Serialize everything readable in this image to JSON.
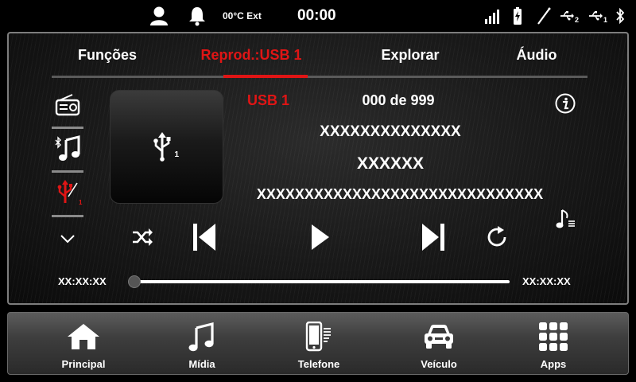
{
  "status": {
    "temperature": "00°C Ext",
    "clock": "00:00",
    "icons": [
      "user-icon",
      "bell-icon",
      "signal-icon",
      "battery-icon",
      "antenna-icon",
      "usb-2-icon",
      "usb-1-icon",
      "bluetooth-icon"
    ],
    "usb_a_sub": "2",
    "usb_b_sub": "1"
  },
  "tabs": [
    {
      "label": "Funções",
      "active": false
    },
    {
      "label": "Reprod.:USB 1",
      "active": true
    },
    {
      "label": "Explorar",
      "active": false
    },
    {
      "label": "Áudio",
      "active": false
    }
  ],
  "player": {
    "source": "USB 1",
    "track_counter": "000 de 999",
    "line1": "XXXXXXXXXXXXXX",
    "line2": "XXXXXX",
    "line3": "XXXXXXXXXXXXXXXXXXXXXXXXXXXXXX",
    "art_usb_sub": "1",
    "elapsed": "XX:XX:XX",
    "total": "XX:XX:XX",
    "progress": 0.0
  },
  "sources": [
    {
      "icon": "radio-icon"
    },
    {
      "icon": "bluetooth-music-icon"
    },
    {
      "icon": "usb-source-icon",
      "active": true,
      "sub": "1"
    }
  ],
  "nav": [
    {
      "label": "Principal",
      "icon": "home-icon"
    },
    {
      "label": "Mídia",
      "icon": "music-note-icon"
    },
    {
      "label": "Telefone",
      "icon": "phone-icon"
    },
    {
      "label": "Veículo",
      "icon": "car-icon"
    },
    {
      "label": "Apps",
      "icon": "apps-grid-icon"
    }
  ],
  "colors": {
    "accent": "#e01515",
    "text": "#ffffff",
    "divider": "#5a5a5a"
  }
}
